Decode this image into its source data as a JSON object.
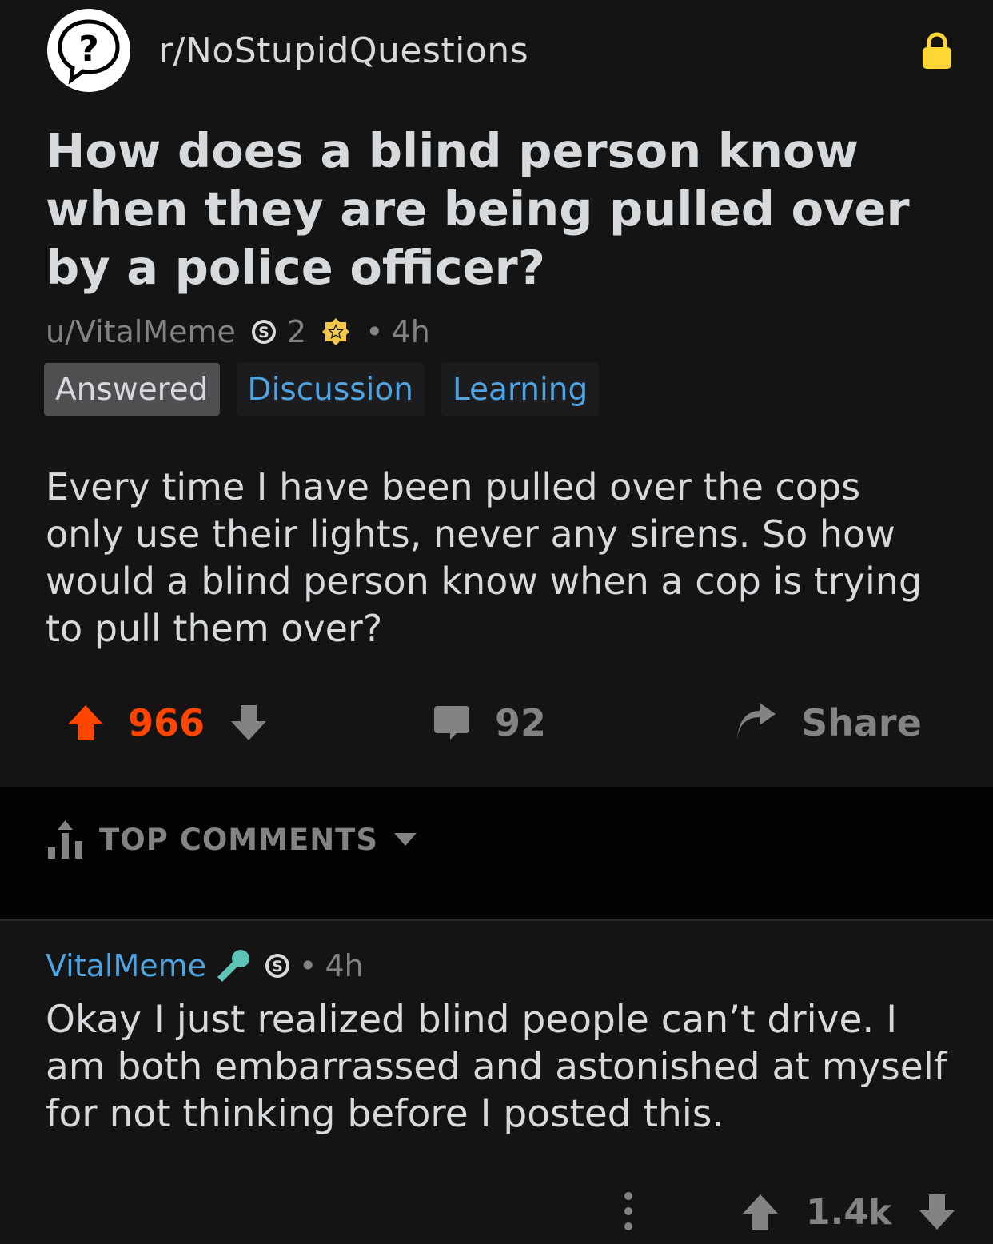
{
  "subreddit": {
    "name": "r/NoStupidQuestions",
    "icon": "question-speech-bubble-icon",
    "locked_icon": "lock-icon"
  },
  "post": {
    "title": "How does a blind person know when they are being pulled over by a police officer?",
    "author": "u/VitalMeme",
    "karma_badge_count": "2",
    "age": "4h",
    "flairs": [
      "Answered",
      "Discussion",
      "Learning"
    ],
    "body": "Every time I have been pulled over the cops only use their lights, never any sirens. So how would a blind person know when a cop is trying to pull them over?",
    "score": "966",
    "comment_count": "92",
    "share_label": "Share"
  },
  "sort": {
    "label": "TOP COMMENTS"
  },
  "comment": {
    "author": "VitalMeme",
    "age": "4h",
    "body": "Okay I just realized blind people can’t drive. I am both embarrassed and astonished at myself for not thinking before I posted this.",
    "score": "1.4k"
  },
  "colors": {
    "background": "#141414",
    "sort_bar": "#030303",
    "upvote_active": "#ff4500",
    "flair_blue": "#4fa3e0",
    "muted": "#818384",
    "lock_yellow": "#ffd635"
  }
}
